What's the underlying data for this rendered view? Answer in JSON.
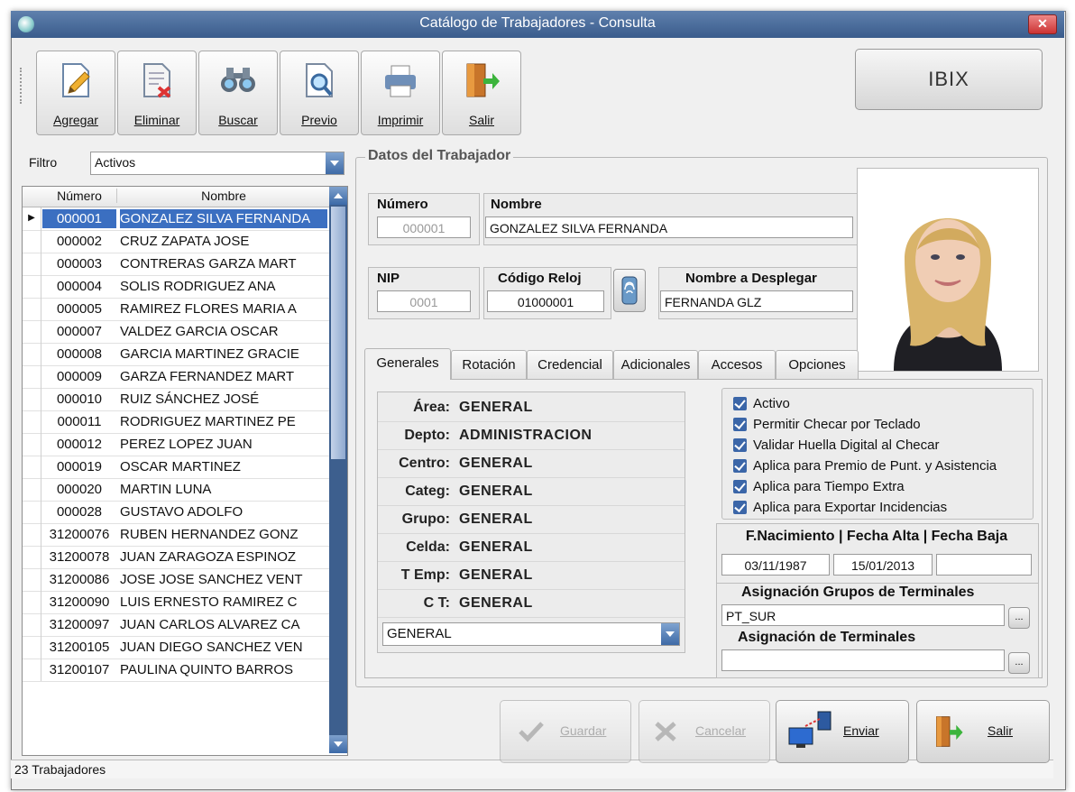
{
  "window": {
    "title": "Catálogo de Trabajadores - Consulta"
  },
  "toolbar": {
    "agregar": "Agregar",
    "eliminar": "Eliminar",
    "buscar": "Buscar",
    "previo": "Previo",
    "imprimir": "Imprimir",
    "salir": "Salir"
  },
  "brand_button": "IBIX",
  "filter": {
    "label": "Filtro",
    "value": "Activos"
  },
  "grid": {
    "headers": {
      "numero": "Número",
      "nombre": "Nombre"
    },
    "rows": [
      {
        "num": "000001",
        "nom": "GONZALEZ SILVA FERNANDA"
      },
      {
        "num": "000002",
        "nom": "CRUZ ZAPATA JOSE"
      },
      {
        "num": "000003",
        "nom": "CONTRERAS GARZA MART"
      },
      {
        "num": "000004",
        "nom": "SOLIS RODRIGUEZ ANA"
      },
      {
        "num": "000005",
        "nom": "RAMIREZ FLORES MARIA A"
      },
      {
        "num": "000007",
        "nom": "VALDEZ GARCIA OSCAR"
      },
      {
        "num": "000008",
        "nom": "GARCIA MARTINEZ GRACIE"
      },
      {
        "num": "000009",
        "nom": "GARZA FERNANDEZ MART"
      },
      {
        "num": "000010",
        "nom": "RUIZ SÁNCHEZ JOSÉ"
      },
      {
        "num": "000011",
        "nom": "RODRIGUEZ MARTINEZ PE"
      },
      {
        "num": "000012",
        "nom": "PEREZ LOPEZ JUAN"
      },
      {
        "num": "000019",
        "nom": "OSCAR MARTINEZ"
      },
      {
        "num": "000020",
        "nom": "MARTIN LUNA"
      },
      {
        "num": "000028",
        "nom": "GUSTAVO ADOLFO"
      },
      {
        "num": "31200076",
        "nom": "RUBEN HERNANDEZ GONZ"
      },
      {
        "num": "31200078",
        "nom": "JUAN ZARAGOZA ESPINOZ"
      },
      {
        "num": "31200086",
        "nom": "JOSE JOSE SANCHEZ VENT"
      },
      {
        "num": "31200090",
        "nom": "LUIS ERNESTO RAMIREZ C"
      },
      {
        "num": "31200097",
        "nom": "JUAN CARLOS ALVAREZ CA"
      },
      {
        "num": "31200105",
        "nom": "JUAN DIEGO SANCHEZ VEN"
      },
      {
        "num": "31200107",
        "nom": "PAULINA QUINTO BARROS"
      }
    ]
  },
  "status": "23 Trabajadores",
  "form": {
    "group_title": "Datos del Trabajador",
    "numero_label": "Número",
    "numero_value": "000001",
    "nombre_label": "Nombre",
    "nombre_value": "GONZALEZ SILVA FERNANDA",
    "nip_label": "NIP",
    "nip_value": "0001",
    "reloj_label": "Código Reloj",
    "reloj_value": "01000001",
    "desplegar_label": "Nombre a Desplegar",
    "desplegar_value": "FERNANDA GLZ"
  },
  "tabs": [
    "Generales",
    "Rotación",
    "Credencial",
    "Adicionales",
    "Accesos",
    "Opciones"
  ],
  "generales": {
    "rows": [
      {
        "k": "Área:",
        "v": "GENERAL"
      },
      {
        "k": "Depto:",
        "v": "ADMINISTRACION"
      },
      {
        "k": "Centro:",
        "v": "GENERAL"
      },
      {
        "k": "Categ:",
        "v": "GENERAL"
      },
      {
        "k": "Grupo:",
        "v": "GENERAL"
      },
      {
        "k": "Celda:",
        "v": "GENERAL"
      },
      {
        "k": "T Emp:",
        "v": "GENERAL"
      },
      {
        "k": "C T:",
        "v": "GENERAL"
      }
    ],
    "combo_value": "GENERAL"
  },
  "checks": [
    "Activo",
    "Permitir Checar por Teclado",
    "Validar Huella Digital al Checar",
    "Aplica para Premio de Punt. y Asistencia",
    "Aplica para Tiempo Extra",
    "Aplica para Exportar Incidencias"
  ],
  "dates": {
    "header": "F.Nacimiento | Fecha Alta | Fecha Baja",
    "nacimiento": "03/11/1987",
    "alta": "15/01/2013",
    "baja": ""
  },
  "asign_grupos": {
    "label": "Asignación Grupos de Terminales",
    "value": "PT_SUR"
  },
  "asign_terminales": {
    "label": "Asignación de Terminales",
    "value": ""
  },
  "ellipsis": "...",
  "buttons": {
    "guardar": "Guardar",
    "cancelar": "Cancelar",
    "enviar": "Enviar",
    "salir": "Salir"
  },
  "colors": {
    "selection": "#3b6fc1",
    "title_bar": "#4a6b9a",
    "checkbox": "#3b66a8"
  }
}
